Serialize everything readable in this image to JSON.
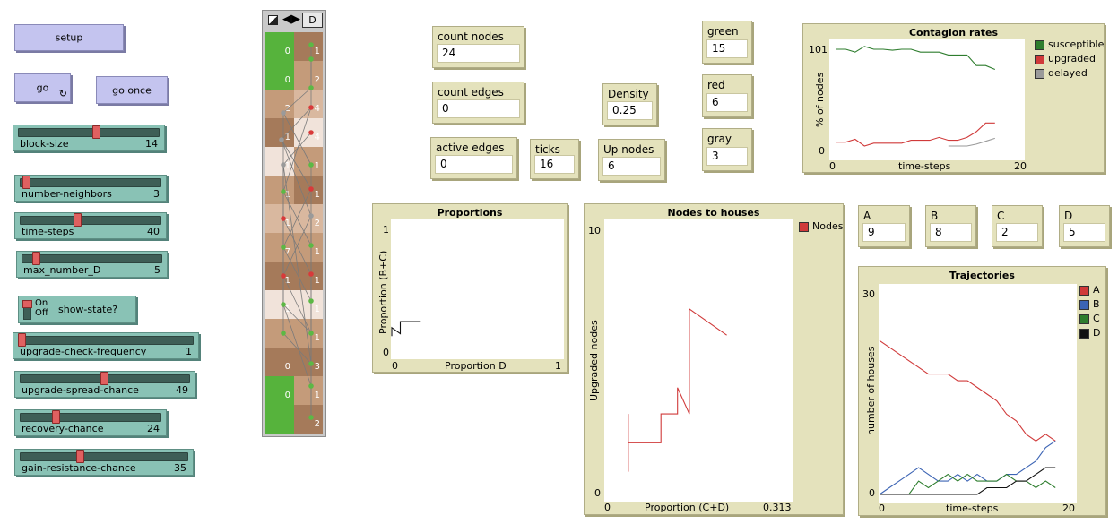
{
  "buttons": {
    "setup": "setup",
    "go": "go",
    "go_once": "go once"
  },
  "sliders": [
    {
      "key": "block_size",
      "label": "block-size",
      "value": "14",
      "fraction": 0.55
    },
    {
      "key": "number_neighbors",
      "label": "number-neighbors",
      "value": "3",
      "fraction": 0.02
    },
    {
      "key": "time_steps",
      "label": "time-steps",
      "value": "40",
      "fraction": 0.4
    },
    {
      "key": "max_number_d",
      "label": "max_number_D",
      "value": "5",
      "fraction": 0.08
    },
    {
      "key": "upgrade_check_frequency",
      "label": "upgrade-check-frequency",
      "value": "1",
      "fraction": 0.0
    },
    {
      "key": "upgrade_spread_chance",
      "label": "upgrade-spread-chance",
      "value": "49",
      "fraction": 0.49
    },
    {
      "key": "recovery_chance",
      "label": "recovery-chance",
      "value": "24",
      "fraction": 0.24
    },
    {
      "key": "gain_resistance_chance",
      "label": "gain-resistance-chance",
      "value": "35",
      "fraction": 0.35
    }
  ],
  "switch": {
    "label": "show-state?",
    "on": "On",
    "off": "Off",
    "state": "off"
  },
  "view_toolbar": {
    "label": "D"
  },
  "view": {
    "left_column_numbers": [
      "0",
      "0",
      "2",
      "1",
      "1",
      "1",
      "1",
      "7",
      "1",
      "1",
      "0",
      "0"
    ],
    "right_column_numbers": [
      "1",
      "2",
      "4",
      "4",
      "1",
      "1",
      "2",
      "1",
      "1",
      "1",
      "1",
      "3",
      "1",
      "2"
    ]
  },
  "monitors": {
    "count_nodes": {
      "label": "count nodes",
      "value": "24"
    },
    "count_edges": {
      "label": "count edges",
      "value": "0"
    },
    "active_edges": {
      "label": "active edges",
      "value": "0"
    },
    "ticks": {
      "label": "ticks",
      "value": "16"
    },
    "up_nodes": {
      "label": "Up nodes",
      "value": "6"
    },
    "density": {
      "label": "Density",
      "value": "0.25"
    },
    "green": {
      "label": "green",
      "value": "15"
    },
    "red": {
      "label": "red",
      "value": "6"
    },
    "gray": {
      "label": "gray",
      "value": "3"
    },
    "a": {
      "label": "A",
      "value": "9"
    },
    "b": {
      "label": "B",
      "value": "8"
    },
    "c": {
      "label": "C",
      "value": "2"
    },
    "d": {
      "label": "D",
      "value": "5"
    }
  },
  "colors": {
    "red": "#d03a3a",
    "green": "#2e7d2e",
    "gray": "#9a9a9a",
    "blue": "#3c64b4",
    "black": "#111111",
    "view_green": "#56b33c"
  },
  "chart_data": [
    {
      "id": "contagion",
      "type": "line",
      "title": "Contagion rates",
      "xlabel": "time-steps",
      "ylabel": "% of nodes",
      "xlim": [
        0,
        20
      ],
      "ylim": [
        0,
        101
      ],
      "x_ticks": [
        "0",
        "20"
      ],
      "y_ticks": [
        "0",
        "101"
      ],
      "legend_position": "right",
      "series": [
        {
          "name": "susceptible",
          "color": "#2e7d2e",
          "points": [
            [
              0,
              101
            ],
            [
              1,
              101
            ],
            [
              2,
              98
            ],
            [
              3,
              104
            ],
            [
              4,
              101
            ],
            [
              5,
              101
            ],
            [
              6,
              100
            ],
            [
              7,
              101
            ],
            [
              8,
              101
            ],
            [
              9,
              98
            ],
            [
              10,
              98
            ],
            [
              11,
              98
            ],
            [
              12,
              95
            ],
            [
              13,
              95
            ],
            [
              14,
              95
            ],
            [
              15,
              84
            ],
            [
              16,
              84
            ],
            [
              17,
              80
            ]
          ]
        },
        {
          "name": "upgraded",
          "color": "#d03a3a",
          "points": [
            [
              0,
              4
            ],
            [
              1,
              4
            ],
            [
              2,
              7
            ],
            [
              3,
              0
            ],
            [
              4,
              3
            ],
            [
              5,
              3
            ],
            [
              6,
              3
            ],
            [
              7,
              3
            ],
            [
              8,
              6
            ],
            [
              9,
              6
            ],
            [
              10,
              6
            ],
            [
              11,
              9
            ],
            [
              12,
              6
            ],
            [
              13,
              6
            ],
            [
              14,
              9
            ],
            [
              15,
              15
            ],
            [
              16,
              24
            ],
            [
              17,
              24
            ]
          ]
        },
        {
          "name": "delayed",
          "color": "#9a9a9a",
          "points": [
            [
              12,
              0
            ],
            [
              13,
              0
            ],
            [
              14,
              0
            ],
            [
              15,
              2
            ],
            [
              16,
              5
            ],
            [
              17,
              8
            ]
          ]
        }
      ]
    },
    {
      "id": "proportions",
      "type": "line",
      "title": "Proportions",
      "xlabel": "Proportion D",
      "ylabel": "Proportion (B+C)",
      "xlim": [
        0,
        1
      ],
      "ylim": [
        0,
        1
      ],
      "x_ticks": [
        "0",
        "1"
      ],
      "y_ticks": [
        "0",
        "1"
      ],
      "series": [
        {
          "name": "",
          "color": "#111111",
          "points": [
            [
              0,
              0.13
            ],
            [
              0,
              0.2
            ],
            [
              0.05,
              0.15
            ],
            [
              0.05,
              0.25
            ],
            [
              0.08,
              0.25
            ],
            [
              0.17,
              0.25
            ]
          ]
        }
      ]
    },
    {
      "id": "nodes_houses",
      "type": "line",
      "title": "Nodes to houses",
      "xlabel": "Proportion (C+D)",
      "ylabel": "Upgraded nodes",
      "xlim": [
        0,
        0.313
      ],
      "ylim": [
        0,
        10
      ],
      "x_ticks": [
        "0",
        "0.313"
      ],
      "y_ticks": [
        "0",
        "10"
      ],
      "legend_position": "right",
      "series": [
        {
          "name": "Nodes",
          "color": "#d03a3a",
          "points": [
            [
              0.039,
              0.8
            ],
            [
              0.039,
              3
            ],
            [
              0.039,
              1.9
            ],
            [
              0.094,
              1.9
            ],
            [
              0.094,
              3
            ],
            [
              0.122,
              3
            ],
            [
              0.122,
              4
            ],
            [
              0.142,
              3
            ],
            [
              0.142,
              7
            ],
            [
              0.205,
              6
            ]
          ]
        }
      ]
    },
    {
      "id": "trajectories",
      "type": "line",
      "title": "Trajectories",
      "xlabel": "time-steps",
      "ylabel": "number of houses",
      "xlim": [
        0,
        20
      ],
      "ylim": [
        0,
        30
      ],
      "x_ticks": [
        "0",
        "20"
      ],
      "y_ticks": [
        "0",
        "30"
      ],
      "legend_position": "right",
      "series": [
        {
          "name": "A",
          "color": "#d03a3a",
          "points": [
            [
              0,
              23
            ],
            [
              1,
              22
            ],
            [
              2,
              21
            ],
            [
              3,
              20
            ],
            [
              4,
              19
            ],
            [
              5,
              18
            ],
            [
              6,
              18
            ],
            [
              7,
              18
            ],
            [
              8,
              17
            ],
            [
              9,
              17
            ],
            [
              10,
              16
            ],
            [
              11,
              15
            ],
            [
              12,
              14
            ],
            [
              13,
              12
            ],
            [
              14,
              11
            ],
            [
              15,
              9
            ],
            [
              16,
              8
            ],
            [
              17,
              9
            ],
            [
              18,
              8
            ]
          ]
        },
        {
          "name": "B",
          "color": "#3c64b4",
          "points": [
            [
              0,
              0
            ],
            [
              1,
              1
            ],
            [
              2,
              2
            ],
            [
              3,
              3
            ],
            [
              4,
              4
            ],
            [
              5,
              3
            ],
            [
              6,
              2
            ],
            [
              7,
              2
            ],
            [
              8,
              3
            ],
            [
              9,
              2
            ],
            [
              10,
              3
            ],
            [
              11,
              2
            ],
            [
              12,
              2
            ],
            [
              13,
              3
            ],
            [
              14,
              3
            ],
            [
              15,
              4
            ],
            [
              16,
              5
            ],
            [
              17,
              7
            ],
            [
              18,
              8
            ]
          ]
        },
        {
          "name": "C",
          "color": "#2e7d2e",
          "points": [
            [
              0,
              0
            ],
            [
              3,
              0
            ],
            [
              4,
              2
            ],
            [
              5,
              1
            ],
            [
              6,
              2
            ],
            [
              7,
              3
            ],
            [
              8,
              2
            ],
            [
              9,
              3
            ],
            [
              10,
              2
            ],
            [
              11,
              2
            ],
            [
              12,
              2
            ],
            [
              13,
              3
            ],
            [
              14,
              2
            ],
            [
              15,
              2
            ],
            [
              16,
              1
            ],
            [
              17,
              2
            ],
            [
              18,
              1
            ]
          ]
        },
        {
          "name": "D",
          "color": "#111111",
          "points": [
            [
              0,
              0
            ],
            [
              9,
              0
            ],
            [
              10,
              0
            ],
            [
              11,
              1
            ],
            [
              12,
              1
            ],
            [
              13,
              1
            ],
            [
              14,
              2
            ],
            [
              15,
              2
            ],
            [
              16,
              3
            ],
            [
              17,
              4
            ],
            [
              18,
              4
            ]
          ]
        }
      ]
    }
  ]
}
